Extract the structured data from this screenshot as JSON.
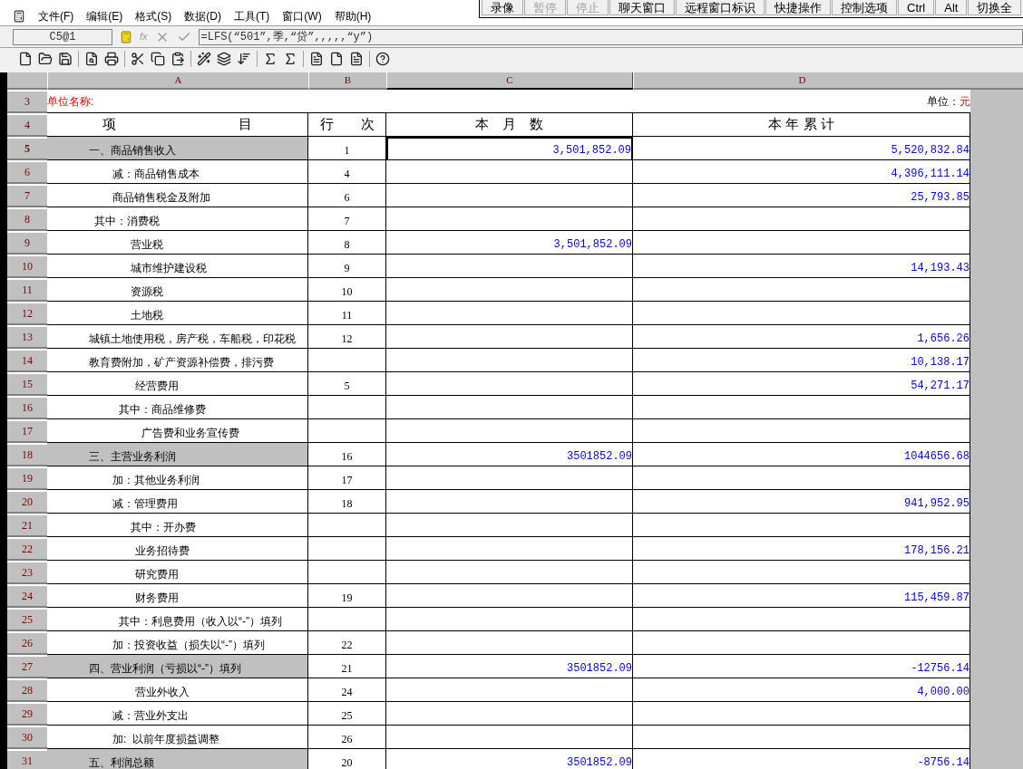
{
  "remote_toolbar": [
    {
      "label": "录像",
      "disabled": false
    },
    {
      "label": "暂停",
      "disabled": true
    },
    {
      "label": "停止",
      "disabled": true
    },
    {
      "label": "聊天窗口",
      "disabled": false
    },
    {
      "label": "远程窗口标识",
      "disabled": false
    },
    {
      "label": "快捷操作",
      "disabled": false
    },
    {
      "label": "控制选项",
      "disabled": false
    },
    {
      "label": "Ctrl",
      "disabled": false
    },
    {
      "label": "Alt",
      "disabled": false
    },
    {
      "label": "切换全",
      "disabled": false
    }
  ],
  "menu": [
    "文件(F)",
    "编辑(E)",
    "格式(S)",
    "数据(D)",
    "工具(T)",
    "窗口(W)",
    "帮助(H)"
  ],
  "formula_bar": {
    "cell": "C5@1",
    "function_label": "fx",
    "formula": "=LFS(“501”,季,“贷”,,,,,“y”)"
  },
  "columns": [
    {
      "label": "A",
      "selected": false
    },
    {
      "label": "B",
      "selected": false
    },
    {
      "label": "C",
      "selected": true
    },
    {
      "label": "D",
      "selected": false
    }
  ],
  "unit_row": {
    "row": "3",
    "name_label": "单位名称:",
    "unit_label": "单位：",
    "unit": "元"
  },
  "header_row": {
    "row": "4",
    "item": "项　　　　　　　　　目",
    "line": "行　　次",
    "month": "本　月　数",
    "year": "本 年 累 计"
  },
  "rows": [
    {
      "row": "5",
      "kind": "top",
      "shaded": true,
      "selected": true,
      "item": "一、商品销售收入",
      "line": "1",
      "month": "3,501,852.09",
      "year": "5,520,832.84"
    },
    {
      "row": "6",
      "kind": "sub",
      "shaded": false,
      "selected": false,
      "item": "减：商品销售成本",
      "line": "4",
      "year": "4,396,111.14"
    },
    {
      "row": "7",
      "kind": "sub",
      "shaded": false,
      "selected": false,
      "item": "商品销售税金及附加",
      "line": "6",
      "year": "25,793.85"
    },
    {
      "row": "8",
      "kind": "note",
      "shaded": false,
      "selected": false,
      "item": "其中：消费税",
      "line": "7"
    },
    {
      "row": "9",
      "kind": "detail",
      "shaded": false,
      "selected": false,
      "item": "营业税",
      "line": "8",
      "month": "3,501,852.09"
    },
    {
      "row": "10",
      "kind": "detail",
      "shaded": false,
      "selected": false,
      "item": "城市维护建设税",
      "line": "9",
      "year": "14,193.43"
    },
    {
      "row": "11",
      "kind": "detail",
      "shaded": false,
      "selected": false,
      "item": "资源税",
      "line": "10"
    },
    {
      "row": "12",
      "kind": "detail",
      "shaded": false,
      "selected": false,
      "item": "土地税",
      "line": "11"
    },
    {
      "row": "13",
      "kind": "top",
      "shaded": false,
      "selected": false,
      "item": "城镇土地使用税，房产税，车船税，印花税",
      "line": "12",
      "year": "1,656.26"
    },
    {
      "row": "14",
      "kind": "top",
      "shaded": false,
      "selected": false,
      "item": "教育费附加，矿产资源补偿费，排污费",
      "year": "10,138.17"
    },
    {
      "row": "15",
      "kind": "item",
      "shaded": false,
      "selected": false,
      "item": "经营费用",
      "line": "5",
      "year": "54,271.17"
    },
    {
      "row": "16",
      "kind": "subnote",
      "shaded": false,
      "selected": false,
      "item": "其中：商品维修费"
    },
    {
      "row": "17",
      "kind": "deep",
      "shaded": false,
      "selected": false,
      "item": "广告费和业务宣传费"
    },
    {
      "row": "18",
      "kind": "top",
      "shaded": true,
      "selected": false,
      "item": "三、主营业务利润",
      "line": "16",
      "month": "3501852.09",
      "year": "1044656.68"
    },
    {
      "row": "19",
      "kind": "sub",
      "shaded": false,
      "selected": false,
      "item": "加：其他业务利润",
      "line": "17"
    },
    {
      "row": "20",
      "kind": "sub",
      "shaded": false,
      "selected": false,
      "item": "减：管理费用",
      "line": "18",
      "year": "941,952.95"
    },
    {
      "row": "21",
      "kind": "detail",
      "shaded": false,
      "selected": false,
      "item": "其中：开办费"
    },
    {
      "row": "22",
      "kind": "item",
      "shaded": false,
      "selected": false,
      "item": "业务招待费",
      "year": "178,156.21"
    },
    {
      "row": "23",
      "kind": "item",
      "shaded": false,
      "selected": false,
      "item": "研究费用"
    },
    {
      "row": "24",
      "kind": "item",
      "shaded": false,
      "selected": false,
      "item": "财务费用",
      "line": "19",
      "year": "115,459.87"
    },
    {
      "row": "25",
      "kind": "subnote",
      "shaded": false,
      "selected": false,
      "item": "其中：利息费用（收入以“-”）填列"
    },
    {
      "row": "26",
      "kind": "sub",
      "shaded": false,
      "selected": false,
      "item": "加：投资收益（损失以“-”）填列",
      "line": "22"
    },
    {
      "row": "27",
      "kind": "top",
      "shaded": true,
      "selected": false,
      "item": "四、营业利润（亏损以“-”）填列",
      "line": "21",
      "month": "3501852.09",
      "year": "-12756.14"
    },
    {
      "row": "28",
      "kind": "item",
      "shaded": false,
      "selected": false,
      "item": "营业外收入",
      "line": "24",
      "year": "4,000.00"
    },
    {
      "row": "29",
      "kind": "sub",
      "shaded": false,
      "selected": false,
      "item": "减：营业外支出",
      "line": "25"
    },
    {
      "row": "30",
      "kind": "sub",
      "shaded": false,
      "selected": false,
      "item": "加:  以前年度损益调整",
      "line": "26"
    },
    {
      "row": "31",
      "kind": "top",
      "shaded": true,
      "selected": false,
      "item": "五、利润总额",
      "line": "20",
      "month": "3501852.09",
      "year": "-8756.14"
    }
  ]
}
